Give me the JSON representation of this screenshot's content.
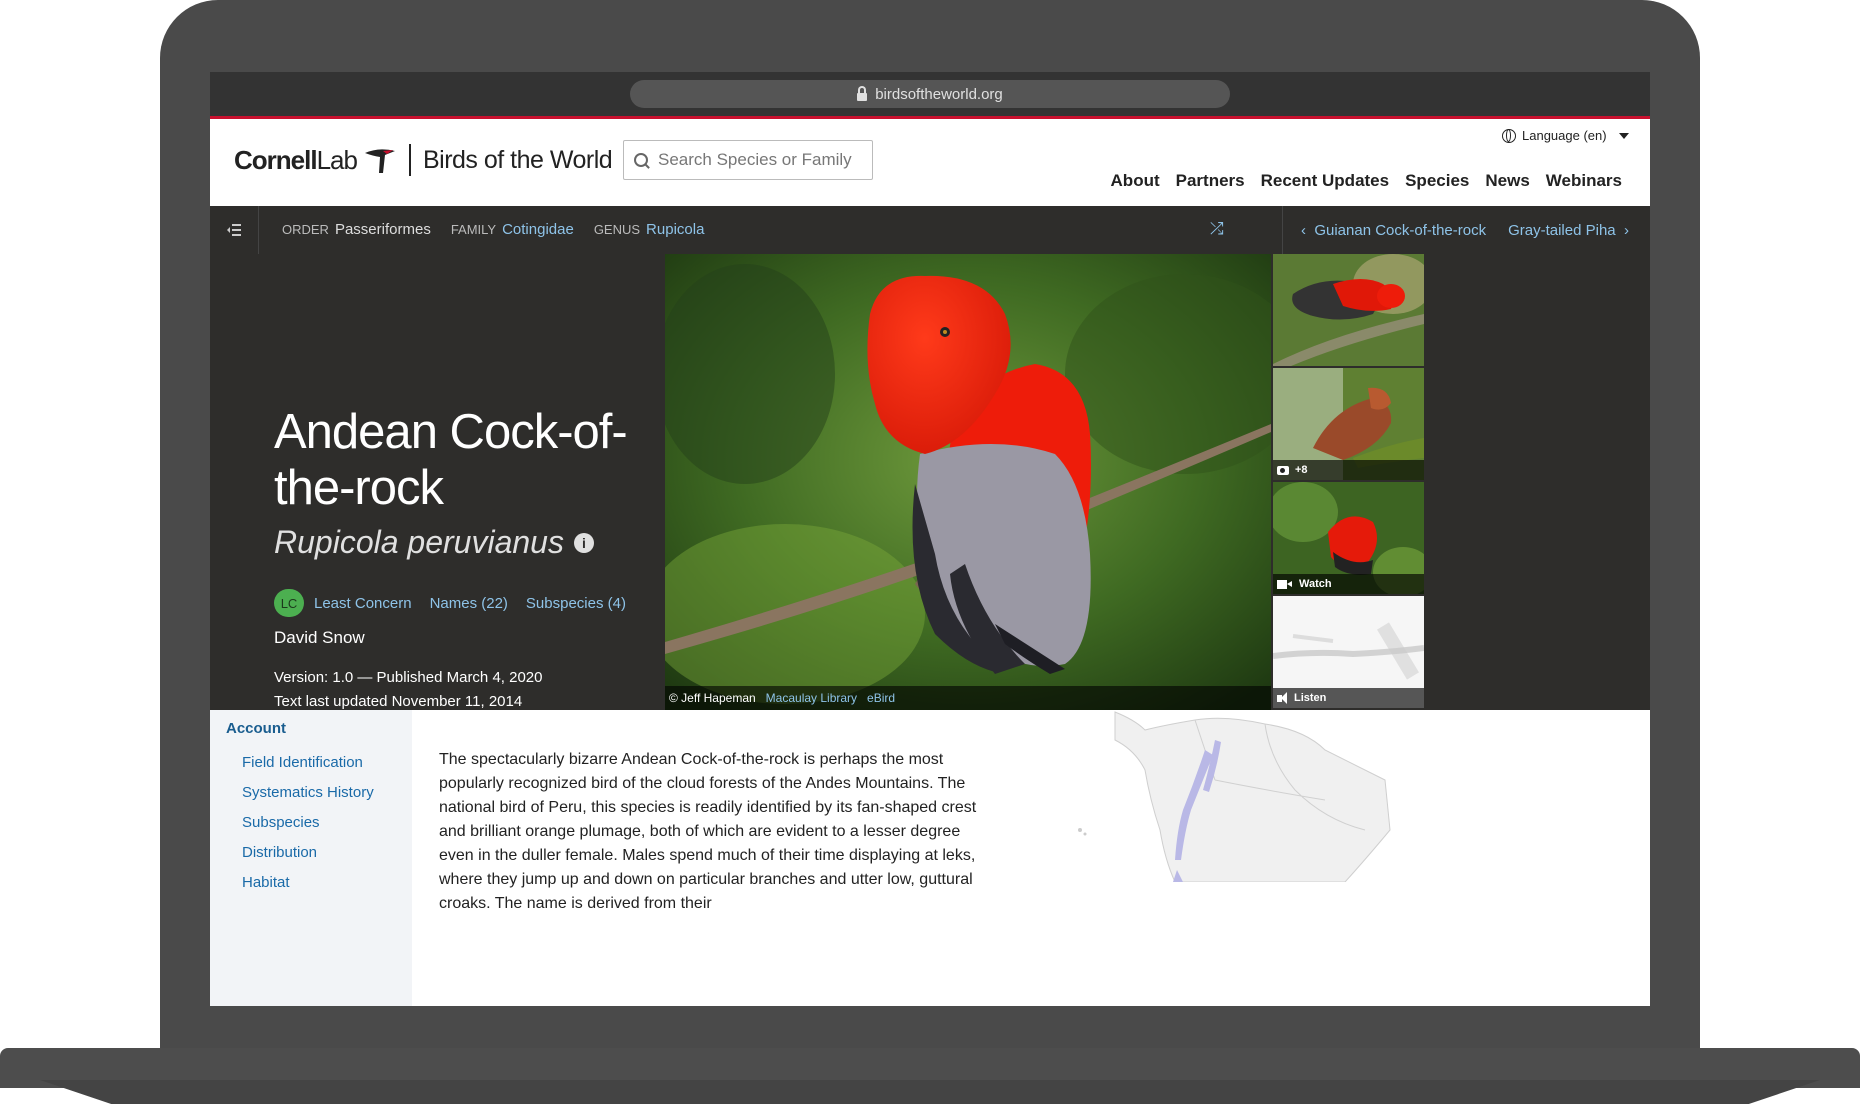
{
  "browser": {
    "url": "birdsoftheworld.org"
  },
  "header": {
    "logo_cornell": "Cornell",
    "logo_lab": "Lab",
    "logo_site": "Birds of the World",
    "search_placeholder": "Search Species or Family",
    "language": "Language (en)",
    "nav": [
      "About",
      "Partners",
      "Recent Updates",
      "Species",
      "News",
      "Webinars"
    ]
  },
  "taxonomy": {
    "order_label": "ORDER",
    "order_value": "Passeriformes",
    "family_label": "FAMILY",
    "family_value": "Cotingidae",
    "genus_label": "GENUS",
    "genus_value": "Rupicola",
    "prev_species": "Guianan Cock-of-the-rock",
    "next_species": "Gray-tailed Piha"
  },
  "species": {
    "common_name": "Andean Cock-of-the-rock",
    "scientific_name": "Rupicola peruvianus",
    "status_code": "LC",
    "status_text": "Least Concern",
    "names_link": "Names (22)",
    "subspecies_link": "Subspecies (4)",
    "author": "David Snow",
    "version": "Version: 1.0 — Published March 4, 2020",
    "text_updated": "Text last updated November 11, 2014"
  },
  "media": {
    "credit": "© Jeff Hapeman",
    "credit_link1": "Macaulay Library",
    "credit_link2": "eBird",
    "photo_count_label": "+8",
    "video_label": "Watch",
    "audio_label": "Listen"
  },
  "sidebar": {
    "title": "Account",
    "items": [
      "Field Identification",
      "Systematics History",
      "Subspecies",
      "Distribution",
      "Habitat"
    ]
  },
  "account_text": "The spectacularly bizarre Andean Cock-of-the-rock is perhaps the most popularly recognized bird of the cloud forests of the Andes Mountains. The national bird of Peru, this species is readily identified by its fan-shaped crest and brilliant orange plumage, both of which are evident to a lesser degree even in the duller female. Males spend much of their time displaying at leks, where they jump up and down on particular branches and utter low, guttural croaks. The name is derived from their",
  "colors": {
    "accent_red": "#c8102e",
    "link_blue": "#8ec3e8",
    "dark_bg": "#2e2d2b",
    "lc_green": "#4caf50"
  }
}
